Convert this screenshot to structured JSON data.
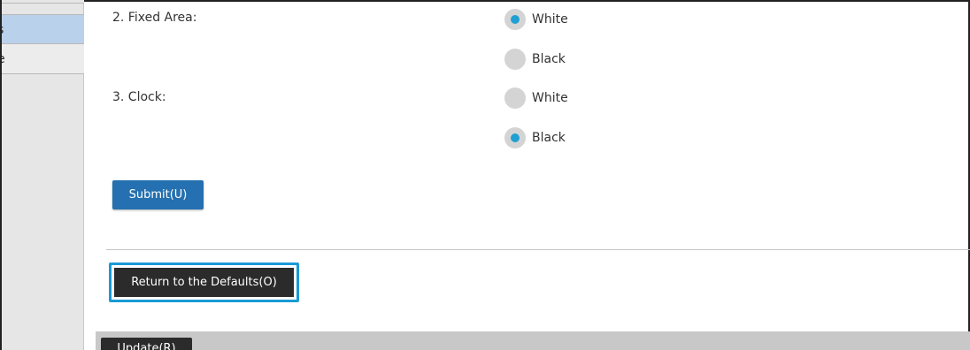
{
  "sidebar": {
    "items": [
      {
        "label": "s"
      },
      {
        "label": "e"
      }
    ]
  },
  "settings": [
    {
      "label": "2. Fixed Area:",
      "options": [
        {
          "label": "White",
          "selected": true
        },
        {
          "label": "Black",
          "selected": false
        }
      ]
    },
    {
      "label": "3. Clock:",
      "options": [
        {
          "label": "White",
          "selected": false
        },
        {
          "label": "Black",
          "selected": true
        }
      ]
    }
  ],
  "buttons": {
    "submit": "Submit(U)",
    "defaults": "Return to the Defaults(O)",
    "update": "Update(R)"
  },
  "colors": {
    "accent": "#1f9fd2",
    "primary_button": "#2470b0",
    "dark_button": "#2b2b2b",
    "sidebar_selected": "#b9d1ea",
    "focus_ring": "#1a9ad6"
  }
}
